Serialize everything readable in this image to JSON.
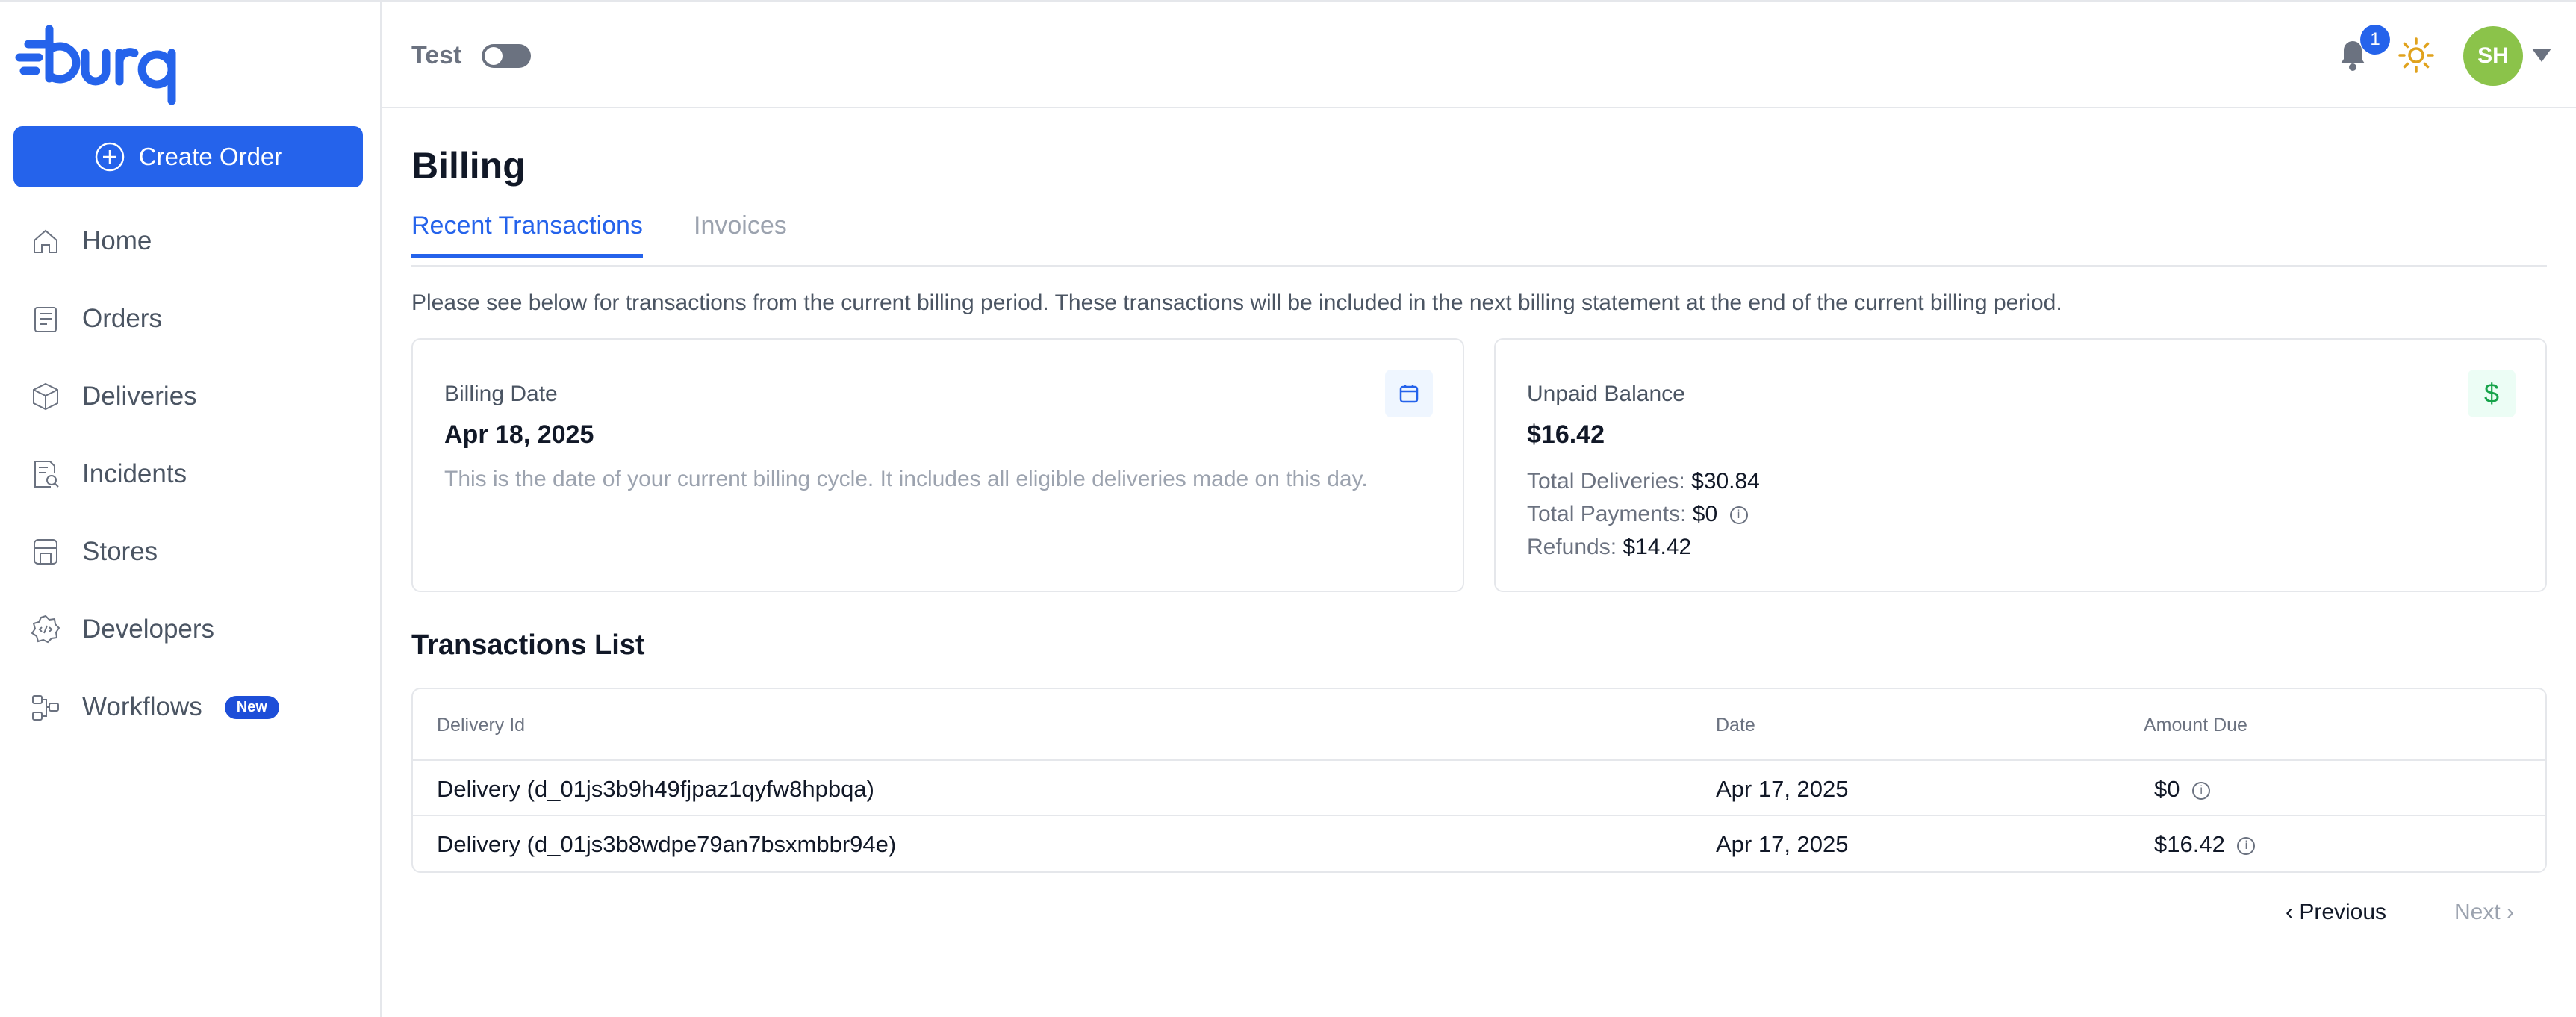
{
  "brand": {
    "name": "burq",
    "color": "#2563eb"
  },
  "sidebar": {
    "create_order": "Create Order",
    "items": [
      {
        "label": "Home",
        "icon": "home-icon"
      },
      {
        "label": "Orders",
        "icon": "orders-icon"
      },
      {
        "label": "Deliveries",
        "icon": "box-icon"
      },
      {
        "label": "Incidents",
        "icon": "incident-search-icon"
      },
      {
        "label": "Stores",
        "icon": "store-icon"
      },
      {
        "label": "Developers",
        "icon": "developer-icon"
      },
      {
        "label": "Workflows",
        "icon": "workflow-icon",
        "badge": "New"
      }
    ]
  },
  "header": {
    "test_label": "Test",
    "test_mode_on": false,
    "notifications_count": "1",
    "avatar_initials": "SH"
  },
  "page": {
    "title": "Billing",
    "tabs": [
      "Recent Transactions",
      "Invoices"
    ],
    "active_tab": "Recent Transactions",
    "intro": "Please see below for transactions from the current billing period. These transactions will be included in the next billing statement at the end of the current billing period."
  },
  "billing_card": {
    "label": "Billing Date",
    "value": "Apr 18, 2025",
    "description": "This is the date of your current billing cycle. It includes all eligible deliveries made on this day."
  },
  "balance_card": {
    "label": "Unpaid Balance",
    "value": "$16.42",
    "lines": [
      {
        "key": "Total Deliveries:",
        "value": "$30.84"
      },
      {
        "key": "Total Payments:",
        "value": "$0"
      },
      {
        "key": "Refunds:",
        "value": "$14.42"
      }
    ]
  },
  "transactions": {
    "title": "Transactions List",
    "columns": [
      "Delivery Id",
      "Date",
      "Amount Due"
    ],
    "rows": [
      {
        "delivery": "Delivery (d_01js3b9h49fjpaz1qyfw8hpbqa)",
        "date": "Apr 17, 2025",
        "amount": "$0"
      },
      {
        "delivery": "Delivery (d_01js3b8wdpe79an7bsxmbbr94e)",
        "date": "Apr 17, 2025",
        "amount": "$16.42"
      }
    ],
    "pagination": {
      "previous": "Previous",
      "next": "Next"
    }
  }
}
